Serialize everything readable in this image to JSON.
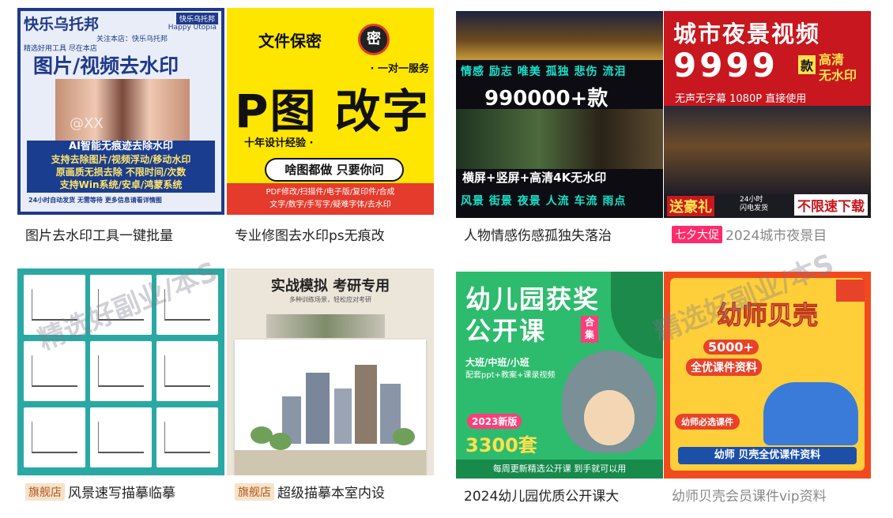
{
  "colors": {
    "tag_flag_bg": "#f6e3c9",
    "tag_flag_fg": "#b4571f",
    "tag_promo_bg": "#ff2b6a"
  },
  "products": [
    {
      "caption": "图片去水印工具一键批量",
      "thumb": {
        "header": "快乐乌托邦",
        "brand_badge": "快乐乌托邦",
        "brand_en": "Happy Utopia",
        "shop_line": "关注本店：快乐乌托邦",
        "tagline": "精选好用工具 尽在本店",
        "headline": "图片/视频去水印",
        "photo_overlay": "@XX",
        "lines": [
          "AI智能无痕迹去除水印",
          "支持去除图片/视频浮动/移动水印",
          "原画质无损去除 不限时间/次数",
          "支持Win系统/安卓/鸿蒙系统"
        ],
        "footer": "24小时自动发货  无需等待  更多信息请看详情图"
      }
    },
    {
      "caption": "专业修图去水印ps无痕改",
      "thumb": {
        "title": "文件保密",
        "seal": "密",
        "service": "· 一对一服务",
        "hero": "P图 改字",
        "experience": "十年设计经验 ·",
        "pill": "啥图都做 只要你问",
        "band_line1": "PDF修改/扫描件/电子版/复印件/合成",
        "band_line2": "文字/数字/手写字/疑难字体/去水印"
      }
    },
    {
      "caption": "人物情感伤感孤独失落治",
      "thumb": {
        "tags_top": "情感 励志 唯美 孤独 悲伤 流泪",
        "count": "990000+款",
        "spec": "横屏+竖屏+高清4K无水印",
        "tags_bottom": "风景 街景 夜景 人流 车流 雨点"
      }
    },
    {
      "caption": "2024城市夜景目",
      "tag": "七夕大促",
      "caption_muted": true,
      "thumb": {
        "title": "城市夜景视频",
        "number": "9999",
        "unit": "款",
        "hd": "高清",
        "no_wm": "无水印",
        "sub": "无声无字幕 1080P  直接使用",
        "gift": "送豪礼",
        "fast1": "24小时",
        "fast2": "闪电发货",
        "unlimited": "不限速下载"
      }
    },
    {
      "caption": "风景速写描摹临摹",
      "tag": "旗舰店",
      "thumb": {}
    },
    {
      "caption": "超级描摹本室内设",
      "tag": "旗舰店",
      "thumb": {
        "title": "实战模拟 考研专用",
        "sub": "多种训练场景，轻松应对考研"
      }
    },
    {
      "caption": "2024幼儿园优质公开课大",
      "thumb": {
        "title1": "幼儿园获奖",
        "title2": "公开课",
        "collection": "合集",
        "classes": "大班/中班/小班",
        "includes": "配套ppt+教案+课录视频",
        "version": "2023新版",
        "count": "3300套",
        "bar": "每周更新精选公开课    到手就可以用"
      }
    },
    {
      "caption": "幼师贝壳会员课件vip资料",
      "caption_muted": true,
      "thumb": {
        "title": "幼师贝壳",
        "count": "5000+",
        "all": "全优课件资料",
        "must": "幼师必选课件",
        "strip": "幼师 贝壳全优课件资料"
      }
    }
  ],
  "watermark": "精选好副业/本S"
}
